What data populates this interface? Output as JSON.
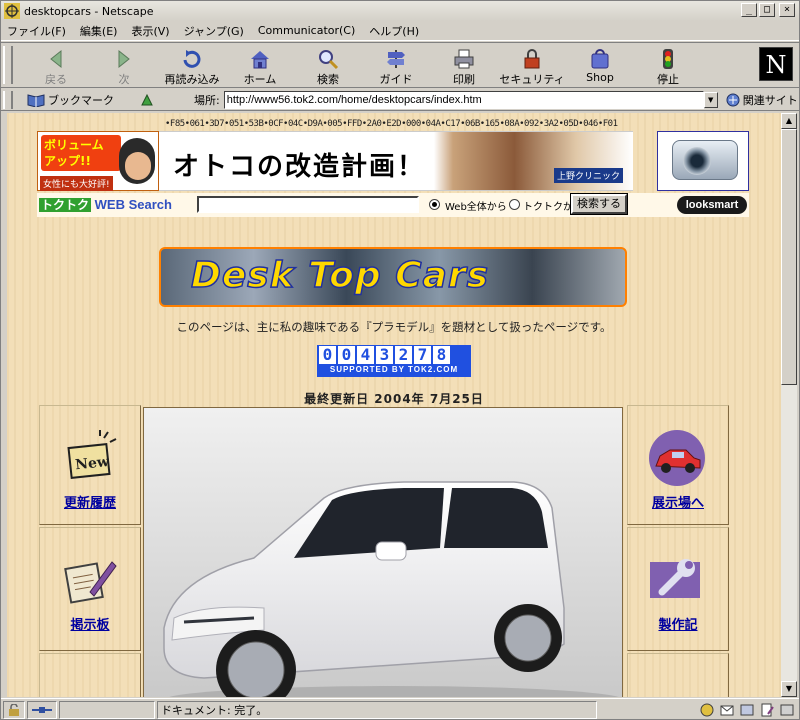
{
  "window": {
    "title": "desktopcars - Netscape",
    "minimize": "_",
    "maximize": "□",
    "close": "×"
  },
  "menu": [
    "ファイル(F)",
    "編集(E)",
    "表示(V)",
    "ジャンプ(G)",
    "Communicator(C)",
    "ヘルプ(H)"
  ],
  "toolbar": {
    "back": "戻る",
    "forward": "次",
    "reload": "再読み込み",
    "home": "ホーム",
    "search": "検索",
    "guide": "ガイド",
    "print": "印刷",
    "security": "セキュリティ",
    "shop": "Shop",
    "stop": "停止",
    "logo": "N"
  },
  "location": {
    "bookmark_label": "ブックマーク",
    "location_label": "場所:",
    "url": "http://www56.tok2.com/home/desktopcars/index.htm",
    "related_label": "関連サイト"
  },
  "page": {
    "hex_string": "•F85•061•3D7•051•53B•0CF•04C•D9A•005•FFD•2A0•E2D•000•04A•C17•06B•165•08A•092•3A2•05D•046•F01",
    "ad_left": {
      "headline": "ボリューム アップ!!",
      "sub": "女性にも大好評!"
    },
    "ad_center": {
      "slogan": "オトコの改造計画！",
      "clinic": "上野クリニック"
    },
    "search": {
      "brand_prefix": "トクトク",
      "brand_text": "WEB Search",
      "option_web": "Web全体から",
      "option_tok": "トクトクから",
      "button": "検索する",
      "powered": "looksmart"
    },
    "logo_text": "Desk Top Cars",
    "intro": "このページは、主に私の趣味である『プラモデル』を題材として扱ったページです。",
    "counter": {
      "digits": [
        "0",
        "0",
        "4",
        "3",
        "2",
        "7",
        "8"
      ],
      "supported": "SUPPORTED BY  TOK2.COM"
    },
    "updated": "最終更新日  2004年    7月25日",
    "nav": {
      "history": "更新履歴",
      "board": "掲示板",
      "showroom": "展示場へ",
      "making": "製作記"
    }
  },
  "status": {
    "text": "ドキュメント: 完了。"
  }
}
